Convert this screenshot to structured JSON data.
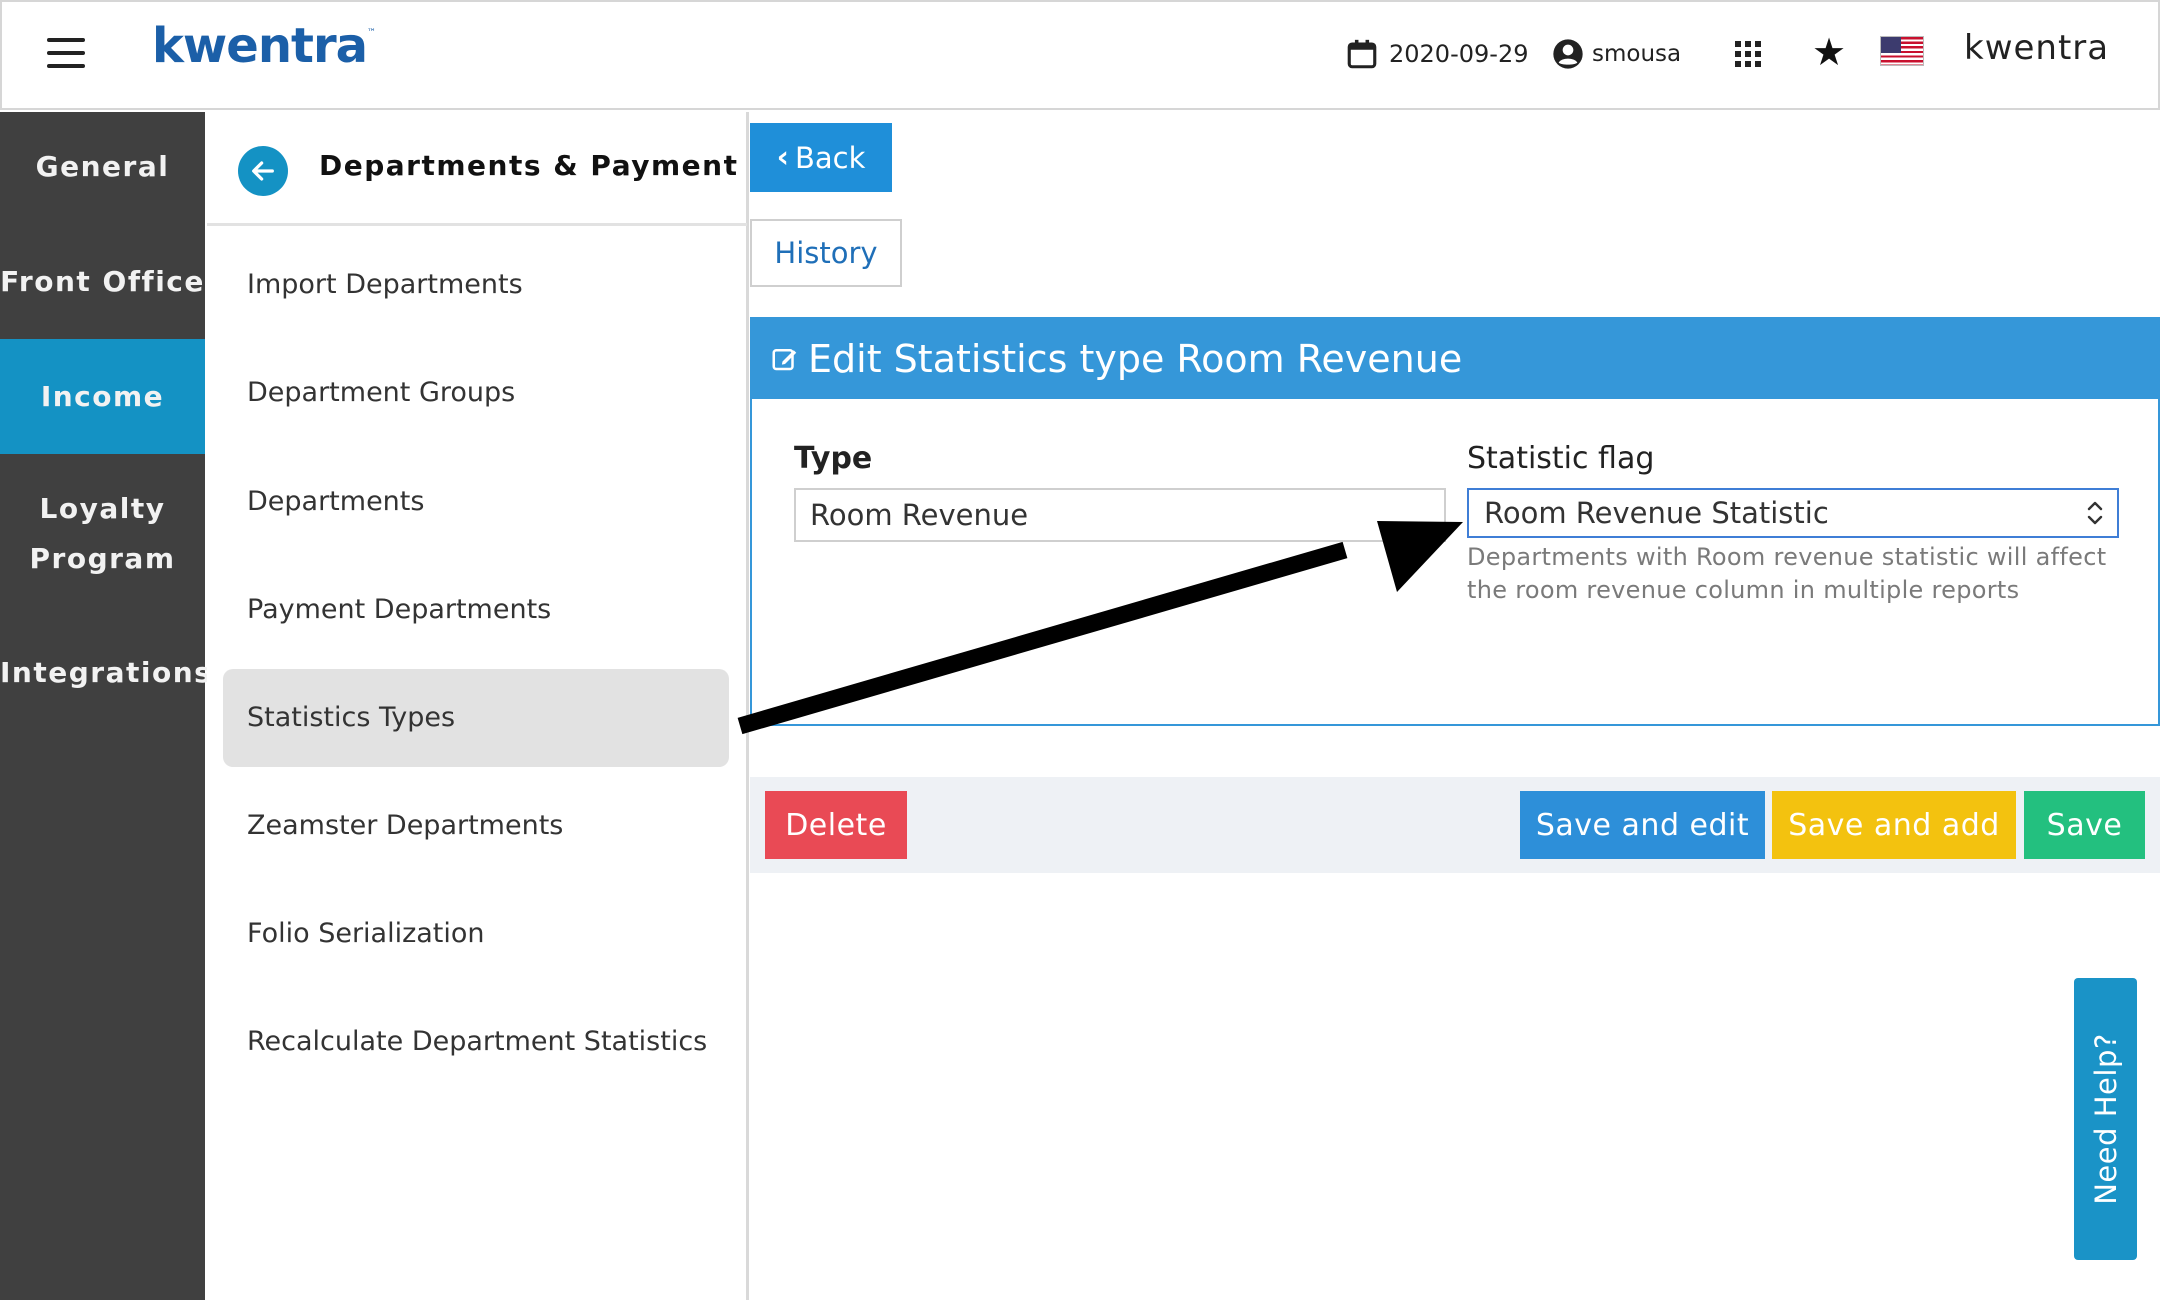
{
  "topbar": {
    "logo_text": "kwentra",
    "logo_tm": "™",
    "date": "2020-09-29",
    "username": "smousa",
    "brand": "kwentra"
  },
  "sidebar": {
    "items": [
      {
        "label": "General"
      },
      {
        "label": "Front Office"
      },
      {
        "label": "Income"
      },
      {
        "label": "Loyalty"
      },
      {
        "label": "Program"
      },
      {
        "label": "Integrations"
      }
    ],
    "active": "Income"
  },
  "submenu": {
    "title": "Departments & Payment",
    "items": [
      {
        "label": "Import Departments"
      },
      {
        "label": "Department Groups"
      },
      {
        "label": "Departments"
      },
      {
        "label": "Payment Departments"
      },
      {
        "label": "Statistics Types"
      },
      {
        "label": "Zeamster Departments"
      },
      {
        "label": "Folio Serialization"
      },
      {
        "label": "Recalculate Department Statistics"
      }
    ],
    "active": "Statistics Types"
  },
  "main": {
    "back_label": "Back",
    "history_label": "History",
    "panel_title": "Edit Statistics type Room Revenue",
    "type_label": "Type",
    "type_value": "Room Revenue",
    "flag_label": "Statistic flag",
    "flag_value": "Room Revenue Statistic",
    "flag_help": "Departments with Room revenue statistic will affect the room revenue column in multiple reports",
    "delete_label": "Delete",
    "save_edit_label": "Save and edit",
    "save_add_label": "Save and add",
    "save_label": "Save"
  },
  "help_tab": "Need Help?",
  "colors": {
    "accent": "#1492c4",
    "panel_blue": "#3597d9",
    "delete": "#e94a55",
    "save_add": "#f3c20f",
    "save": "#23c07f",
    "sidebar_bg": "#404040"
  }
}
